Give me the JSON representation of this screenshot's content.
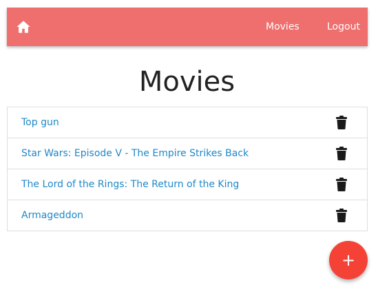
{
  "navbar": {
    "home_icon": "home-icon",
    "links": [
      {
        "label": "Movies"
      },
      {
        "label": "Logout"
      }
    ],
    "background_color": "#ef6e6e"
  },
  "page": {
    "title": "Movies"
  },
  "movies": [
    {
      "title": "Top gun",
      "action_icon": "trash-icon"
    },
    {
      "title": "Star Wars: Episode V - The Empire Strikes Back",
      "action_icon": "trash-icon"
    },
    {
      "title": "The Lord of the Rings: The Return of the King",
      "action_icon": "trash-icon"
    },
    {
      "title": "Armageddon",
      "action_icon": "trash-icon"
    }
  ],
  "fab": {
    "label": "+",
    "color": "#f44336"
  },
  "colors": {
    "link": "#1e88c7",
    "title": "#222222"
  }
}
